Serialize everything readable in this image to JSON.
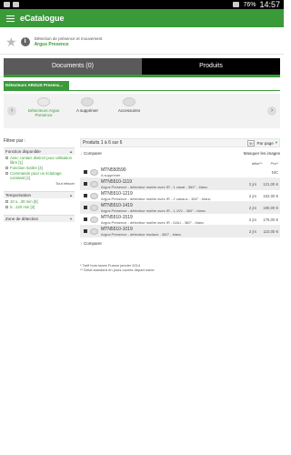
{
  "status_bar": {
    "time": "14:57",
    "battery": "76%"
  },
  "app": {
    "title": "eCatalogue"
  },
  "favorite": {
    "line1": "Détection de présence et mouvement",
    "line2": "Argus Presence"
  },
  "tabs": [
    {
      "label": "Documents (0)"
    },
    {
      "label": "Produits"
    }
  ],
  "breadcrumb": "Détecteurs ARGUS Presenc...",
  "categories": [
    {
      "label": "Détecteurs Argus Presence"
    },
    {
      "label": "A supprimer"
    },
    {
      "label": "Accessoires"
    }
  ],
  "filters": {
    "title": "Filtrer par :",
    "sections": [
      {
        "label": "Fonction disponible",
        "options": [
          "Avec contact distinct pour utilisation libre [1]",
          "Fonction maître [4]",
          "Commande pour un éclairage constant [1]"
        ],
        "reset": "Tout effacer"
      },
      {
        "label": "Temporisation",
        "options": [
          "10 s...30 min [5]",
          "5...120 min [2]"
        ]
      },
      {
        "label": "Zone de détection",
        "options": []
      }
    ]
  },
  "products": {
    "summary": "Produits 1 à 6 sur 6",
    "per_page_value": "50",
    "per_page_label": "Par page",
    "compare_label": "Comparer",
    "hide_images_label": "Masquer les images",
    "col_delay": "délai**",
    "col_price": "Prix*",
    "rows": [
      {
        "ref": "MTN550590",
        "name": "A supprimer",
        "delay": "",
        "price": "N/C"
      },
      {
        "ref": "MTN5510-1119",
        "name": "Argus Presence - détecteur maître avec IR - 1 canal - 360° - blanc",
        "delay": "2 jrs",
        "price": "121,00 €"
      },
      {
        "ref": "MTN5510-1219",
        "name": "Argus Presence - détecteur maître avec IR - 2 canaux - 360° - blanc",
        "delay": "2 jrs",
        "price": "152,00 €"
      },
      {
        "ref": "MTN5510-1419",
        "name": "Argus Presence - détecteur maître avec IR - 1-10V - 360° - blanc",
        "delay": "2 jrs",
        "price": "190,00 €"
      },
      {
        "ref": "MTN5510-1519",
        "name": "Argus Presence - détecteur maître avec IR - DALI - 360° - blanc",
        "delay": "2 jrs",
        "price": "175,00 €"
      },
      {
        "ref": "MTN5510-1019",
        "name": "Argus Presence - détecteur esclave - 360° - blanc",
        "delay": "2 jrs",
        "price": "110,00 €"
      }
    ],
    "footnote_1": "* Tarif hors taxes France janvier 2014",
    "footnote_2": "** Délai standard en jours ouvrés départ usine"
  }
}
